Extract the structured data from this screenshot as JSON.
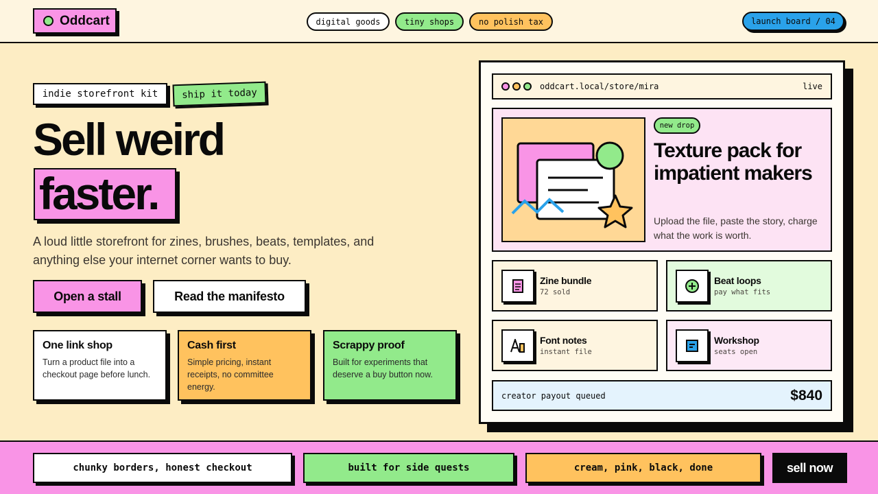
{
  "header": {
    "brand": "Oddcart",
    "pills": [
      "digital goods",
      "tiny shops",
      "no polish tax"
    ],
    "launch_board": "launch board / 04"
  },
  "hero": {
    "tags": [
      "indie storefront kit",
      "ship it today"
    ],
    "headline_line1": "Sell weird",
    "headline_line2": "faster.",
    "lead": "A loud little storefront for zines, brushes, beats, templates, and anything else your internet corner wants to buy.",
    "primary_cta": "Open a stall",
    "secondary_cta": "Read the manifesto",
    "cards": [
      {
        "title": "One link shop",
        "body": "Turn a product file into a checkout page before lunch."
      },
      {
        "title": "Cash first",
        "body": "Simple pricing, instant receipts, no committee energy."
      },
      {
        "title": "Scrappy proof",
        "body": "Built for experiments that deserve a buy button now."
      }
    ]
  },
  "preview": {
    "url": "oddcart.local/store/mira",
    "status": "live",
    "feature": {
      "badge": "new drop",
      "title": "Texture pack for impatient makers",
      "description": "Upload the file, paste the story, charge what the work is worth."
    },
    "products": [
      {
        "name": "Zine bundle",
        "meta": "72 sold",
        "icon": "document-icon"
      },
      {
        "name": "Beat loops",
        "meta": "pay what fits",
        "icon": "plus-circle-icon"
      },
      {
        "name": "Font notes",
        "meta": "instant file",
        "icon": "font-icon"
      },
      {
        "name": "Workshop",
        "meta": "seats open",
        "icon": "calendar-icon"
      }
    ],
    "payout_label": "creator payout queued",
    "payout_amount": "$840"
  },
  "footer": {
    "pills": [
      "chunky borders, honest checkout",
      "built for side quests",
      "cream, pink, black, done"
    ],
    "cta": "sell now"
  },
  "colors": {
    "cream": "#fdedc4",
    "pink": "#f994e6",
    "green": "#92ea8b",
    "orange": "#ffc25e",
    "blue": "#2aa2ea",
    "black": "#0a0a0a"
  }
}
